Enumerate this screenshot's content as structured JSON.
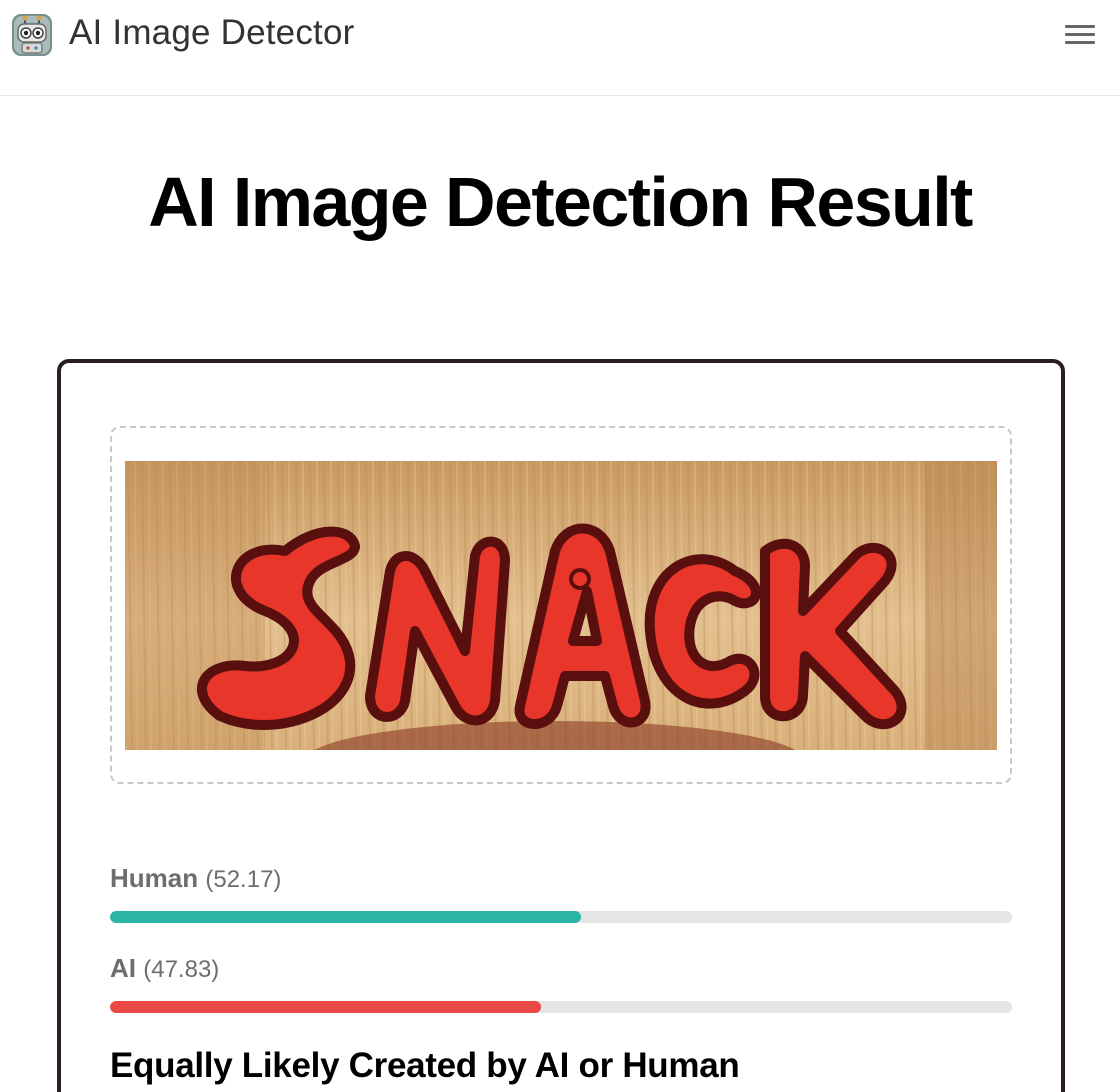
{
  "app": {
    "title": "AI Image Detector"
  },
  "page": {
    "title": "AI Image Detection Result"
  },
  "image": {
    "lettering": "SNACK"
  },
  "scores": [
    {
      "label": "Human",
      "value": "52.17",
      "fraction": 0.5217,
      "color": "#2ab5a6"
    },
    {
      "label": "AI",
      "value": "47.83",
      "fraction": 0.4783,
      "color": "#ea4747"
    }
  ],
  "verdict": "Equally Likely Created by AI or Human",
  "icons": {
    "logo": "robot-logo-icon",
    "menu": "hamburger-menu-icon"
  }
}
